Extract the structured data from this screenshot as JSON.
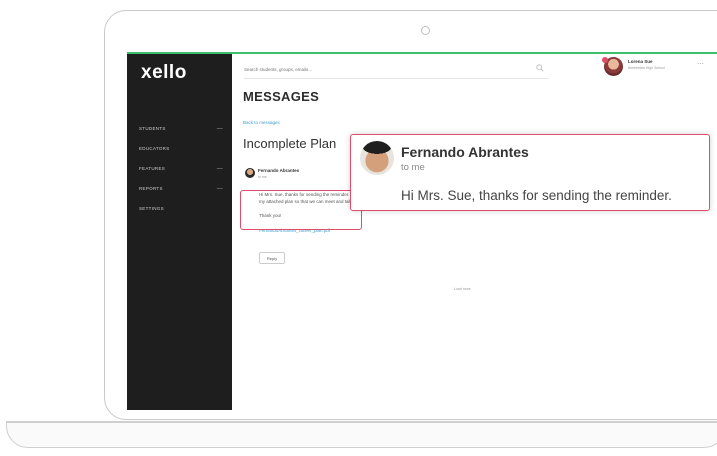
{
  "app": {
    "logo": "xello"
  },
  "sidebar": {
    "items": [
      {
        "label": "STUDENTS",
        "chevron": true
      },
      {
        "label": "EDUCATORS",
        "chevron": false
      },
      {
        "label": "FEATURES",
        "chevron": true
      },
      {
        "label": "REPORTS",
        "chevron": true
      },
      {
        "label": "SETTINGS",
        "chevron": false
      }
    ]
  },
  "topbar": {
    "search_placeholder": "Search students, groups, emails...",
    "user_name": "Lorena Sue",
    "user_subtitle": "Aimeeview High School"
  },
  "main": {
    "page_title": "MESSAGES",
    "back_link": "Back to messages",
    "subject": "Incomplete Plan",
    "message": {
      "sender": "Fernando Abrantes",
      "to": "to me",
      "body_line_1": "Hi Mrs. Sue, thanks for sending the reminder. I will be submitting the plan by the end of the week. Can you give",
      "body_line_2": "my attached plan so that we can meet and talk about it tomorrow?",
      "thanks": "Thank you!",
      "attachment": "FernandoAbrantes_career_plan.pdf",
      "reply_label": "Reply"
    },
    "bottom_link": "Load more"
  },
  "callout": {
    "sender": "Fernando Abrantes",
    "to": "to me",
    "body": "Hi Mrs. Sue, thanks for sending the reminder."
  },
  "colors": {
    "accent_green": "#3ac16c",
    "highlight_pink": "#e04d6b",
    "link_blue": "#3a9fd6",
    "sidebar_bg": "#1e1e1f"
  }
}
